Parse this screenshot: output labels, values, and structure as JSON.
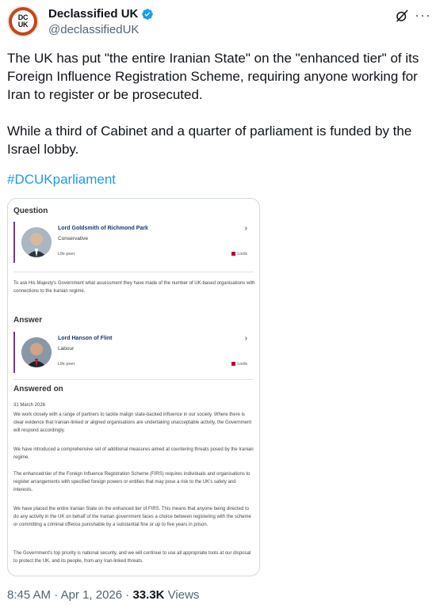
{
  "author": {
    "avatar_text_top": "DC",
    "avatar_text_bottom": "UK",
    "name": "Declassified UK",
    "handle": "@declassifiedUK"
  },
  "tweet": {
    "paragraph1": "The UK has put \"the entire Iranian State\" on the \"enhanced tier\" of its Foreign Influence Registration Scheme, requiring anyone working for Iran to register or be prosecuted.",
    "paragraph2": "While a third of Cabinet and a quarter of parliament is funded by the Israel lobby.",
    "hashtag": "#DCUKparliament"
  },
  "card": {
    "question_heading": "Question",
    "questioner": {
      "name": "Lord Goldsmith of Richmond Park",
      "party": "Conservative",
      "role": "Life peer",
      "house": "Lords"
    },
    "question_text": "To ask His Majesty's Government what assessment they have made of the number of UK-based organisations with connections to the Iranian regime.",
    "answer_heading": "Answer",
    "answerer": {
      "name": "Lord Hanson of Flint",
      "party": "Labour",
      "role": "Life peer",
      "house": "Lords"
    },
    "answered_on_heading": "Answered on",
    "answered_date": "31 March 2026",
    "answer_paragraphs": [
      "We work closely with a range of partners to tackle malign state-backed influence in our society. Where there is clear evidence that Iranian-linked or aligned organisations are undertaking unacceptable activity, the Government will respond accordingly.",
      "We have introduced a comprehensive set of additional measures aimed at countering threats posed by the Iranian regime.",
      "The enhanced tier of the Foreign Influence Registration Scheme (FIRS) requires individuals and organisations to register arrangements with specified foreign powers or entities that may pose a risk to the UK's safety and interests.",
      "We have placed the entire Iranian State on the enhanced tier of FIRS. This means that anyone being directed to do any activity in the UK on behalf of the Iranian government faces a choice between registering with the scheme or committing a criminal offence punishable by a substantial fine or up to five years in prison.",
      "The Government's top priority is national security, and we will continue to use all appropriate tools at our disposal to protect the UK, and its people, from any Iran-linked threats."
    ]
  },
  "footer": {
    "time": "8:45 AM",
    "sep1": " · ",
    "date": "Apr 1, 2026",
    "sep2": " · ",
    "views_count": "33.3K",
    "views_label": " Views"
  },
  "icons": {
    "verified": "verified-badge-icon",
    "grok": "grok-icon",
    "more": "more-icon",
    "chevron": "chevron-right-icon"
  },
  "colors": {
    "link": "#1d9bf0",
    "verified": "#1d9bf0",
    "lords_red": "#b50938",
    "member_bar": "#6b3e8e"
  }
}
